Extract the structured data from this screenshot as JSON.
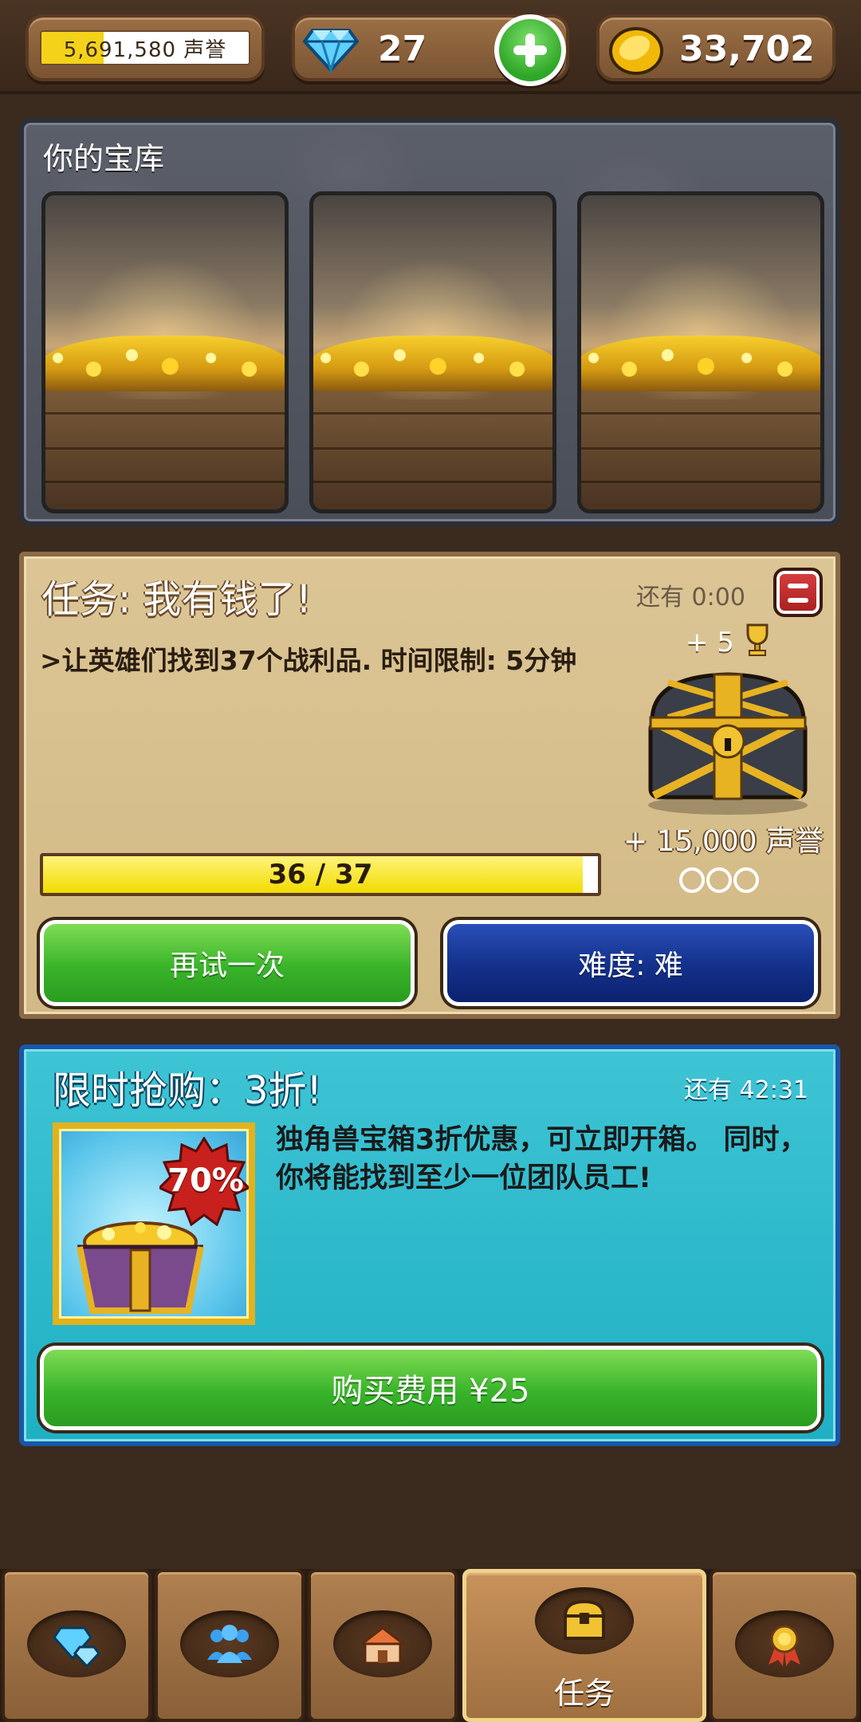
{
  "topbar": {
    "reputation": {
      "text": "5,691,580 声誉",
      "progress": 0.3
    },
    "gems": {
      "count": "27",
      "icon": "diamond-icon",
      "add_icon": "plus-icon"
    },
    "gold": {
      "count": "33,702",
      "icon": "coin-icon"
    }
  },
  "vault": {
    "title": "你的宝库",
    "slots": [
      {
        "content": "gold-pile"
      },
      {
        "content": "gold-pile"
      },
      {
        "content": "gold-pile"
      }
    ]
  },
  "quest": {
    "title": "任务: 我有钱了!",
    "time_left": "还有 0:00",
    "description": ">让英雄们找到37个战利品. 时间限制: 5分钟",
    "trophy_reward": "+ 5",
    "reputation_reward": "+ 15,000 声誉",
    "progress": {
      "current": 36,
      "total": 37,
      "text": "36 / 37"
    },
    "stars": {
      "earned": 0,
      "total": 3
    },
    "retry_label": "再试一次",
    "difficulty_label": "难度: 难"
  },
  "sale": {
    "title": "限时抢购：3折!",
    "time_left": "还有 42:31",
    "badge": "70%",
    "description": "独角兽宝箱3折优惠，可立即开箱。 同时，你将能找到至少一位团队员工!",
    "buy_label": "购买费用 ¥25"
  },
  "nav": {
    "tabs": [
      {
        "icon": "gems-icon",
        "label": ""
      },
      {
        "icon": "heroes-icon",
        "label": ""
      },
      {
        "icon": "town-icon",
        "label": ""
      },
      {
        "icon": "chest-icon",
        "label": "任务",
        "active": true
      },
      {
        "icon": "medal-icon",
        "label": ""
      }
    ]
  },
  "colors": {
    "quest_panel": "#d8c08e",
    "sale_panel": "#2fbacd",
    "green_button": "#39b42a",
    "blue_button": "#13308a",
    "progress_fill": "#f1dc00"
  }
}
